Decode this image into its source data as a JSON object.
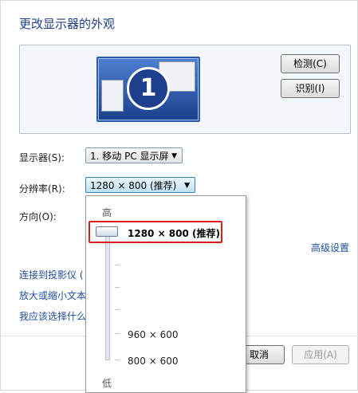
{
  "window": {
    "title": "更改显示器的外观"
  },
  "preview": {
    "monitor_number": "1",
    "detect_label": "检测(C)",
    "identify_label": "识别(I)"
  },
  "settings": {
    "display_label": "显示器(S):",
    "display_value": "1. 移动 PC 显示屏",
    "resolution_label": "分辨率(R):",
    "resolution_value": "1280 × 800 (推荐)",
    "orientation_label": "方向(O):",
    "advanced_link": "高级设置"
  },
  "links": {
    "projector": "连接到投影仪 (",
    "text_size": "放大或缩小文本",
    "which_settings": "我应该选择什么"
  },
  "resolution_dropdown": {
    "high_label": "高",
    "low_label": "低",
    "options": [
      "1280 × 800 (推荐)",
      "960 × 600",
      "800 × 600"
    ],
    "selected_index": 0
  },
  "footer": {
    "cancel_label": "取消",
    "apply_label": "应用(A)"
  },
  "colors": {
    "title_blue": "#1f3e8c",
    "link_blue": "#1f4fa0",
    "highlight_red": "#d62020",
    "monitor_blue": "#2b5bb8"
  }
}
